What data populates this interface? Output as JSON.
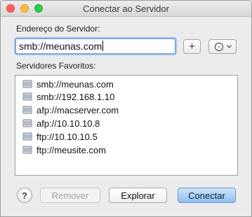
{
  "window": {
    "title": "Conectar ao Servidor"
  },
  "server_address": {
    "label": "Endereço do Servidor:",
    "value": "smb://meunas.com",
    "add_label": "+"
  },
  "favorites": {
    "label": "Servidores Favoritos:",
    "items": [
      {
        "label": "smb://meunas.com",
        "icon": "server-icon"
      },
      {
        "label": "smb://192.168.1.10",
        "icon": "server-icon"
      },
      {
        "label": "afp://macserver.com",
        "icon": "server-icon"
      },
      {
        "label": "afp://10.10.10.8",
        "icon": "server-icon"
      },
      {
        "label": "ftp://10.10.10.5",
        "icon": "server-icon"
      },
      {
        "label": "ftp://meusite.com",
        "icon": "server-icon"
      }
    ]
  },
  "buttons": {
    "help": "?",
    "remove": "Remover",
    "browse": "Explorar",
    "connect": "Conectar"
  },
  "colors": {
    "accent": "#8fc0f2",
    "focus_ring": "#7aa7e0",
    "close": "#fc605c",
    "minimize": "#fdbc40",
    "zoom": "#34c84a"
  }
}
